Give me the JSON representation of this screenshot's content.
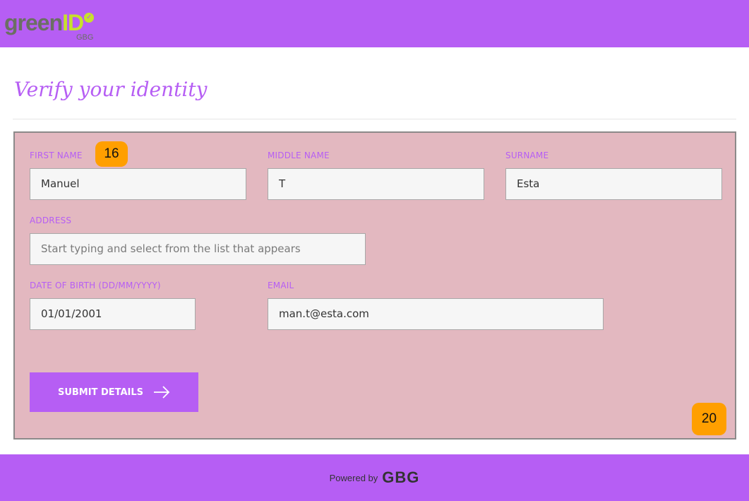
{
  "header": {
    "logo_main": "green",
    "logo_accent": "ID",
    "logo_sub": "GBG"
  },
  "page": {
    "title": "Verify your identity"
  },
  "form": {
    "first_name": {
      "label": "FIRST NAME",
      "value": "Manuel"
    },
    "middle_name": {
      "label": "MIDDLE NAME",
      "value": "T"
    },
    "surname": {
      "label": "SURNAME",
      "value": "Esta"
    },
    "address": {
      "label": "ADDRESS",
      "placeholder": "Start typing and select from the list that appears"
    },
    "dob": {
      "label": "DATE OF BIRTH (DD/MM/YYYY)",
      "value": "01/01/2001"
    },
    "email": {
      "label": "EMAIL",
      "value": "man.t@esta.com"
    },
    "submit_label": "SUBMIT DETAILS"
  },
  "badges": {
    "first": "16",
    "second": "20"
  },
  "footer": {
    "powered_by": "Powered by",
    "brand": "GBG"
  },
  "colors": {
    "brand_purple": "#b65ef4",
    "panel_pink": "#e3b8c0",
    "badge_orange": "#ff9f00",
    "logo_lime": "#c7e02c"
  },
  "icons": {
    "submit": "arrow-right-icon",
    "logo_check": "check-circle-icon"
  }
}
